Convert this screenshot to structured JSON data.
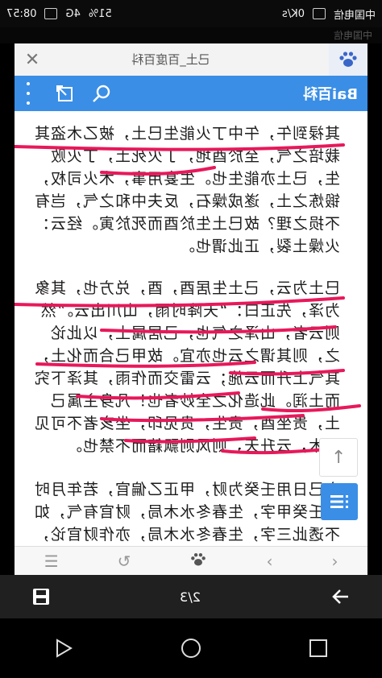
{
  "status_bar": {
    "time": "08:57",
    "speed": "0K/s",
    "network": "4G",
    "signal": "51%",
    "carrier": "中国电信"
  },
  "ghost_text": "中国电信",
  "page": {
    "title": "己土_百度百科",
    "brand": "Bai百科"
  },
  "content": {
    "paragraphs": [
      "其禄到午，午中丁火能生巳土，被乙木盗其栽培之气，至於酉地，丁火死土，丁火败生，已土亦能生也。生宴用事，木火司权，锻炼之土，遂成燥石，反夫中和之气，岂有不损之理？故巳土生於酉而死於寅。经云：火燥土裂，正此谓也。",
      "巳土为云，己土生居酉，酉，兑方也，其象为泽，先正曰：“天降时雨，山川出云。”然则云者，山泽之气也，己居属土，以此论之，则其谓之云也亦宜。故甲己合而化土，其气上升而云施；云雷交而作雨，其泽下究而土润。此造化之全妙者也！凡身主属己土，贵坐酉，贵生，贵见印，坐亥者不可见乙木，云升天，则风则飘籍而不禁也。",
      "六己日用壬癸为财，甲正乙偏官，若年月时透壬癸甲字，生春冬水木局，财官有气，如不透此三字，生春冬水木局，亦作财官论，见戊己"
    ]
  },
  "toolbar": {
    "menu_label": "☰",
    "refresh_label": "↻",
    "back_label": "‹",
    "forward_label": "›"
  },
  "pager": {
    "page_indicator": "2/3"
  },
  "accent_color": "#3a8ee6",
  "ink_color": "#e8185a"
}
